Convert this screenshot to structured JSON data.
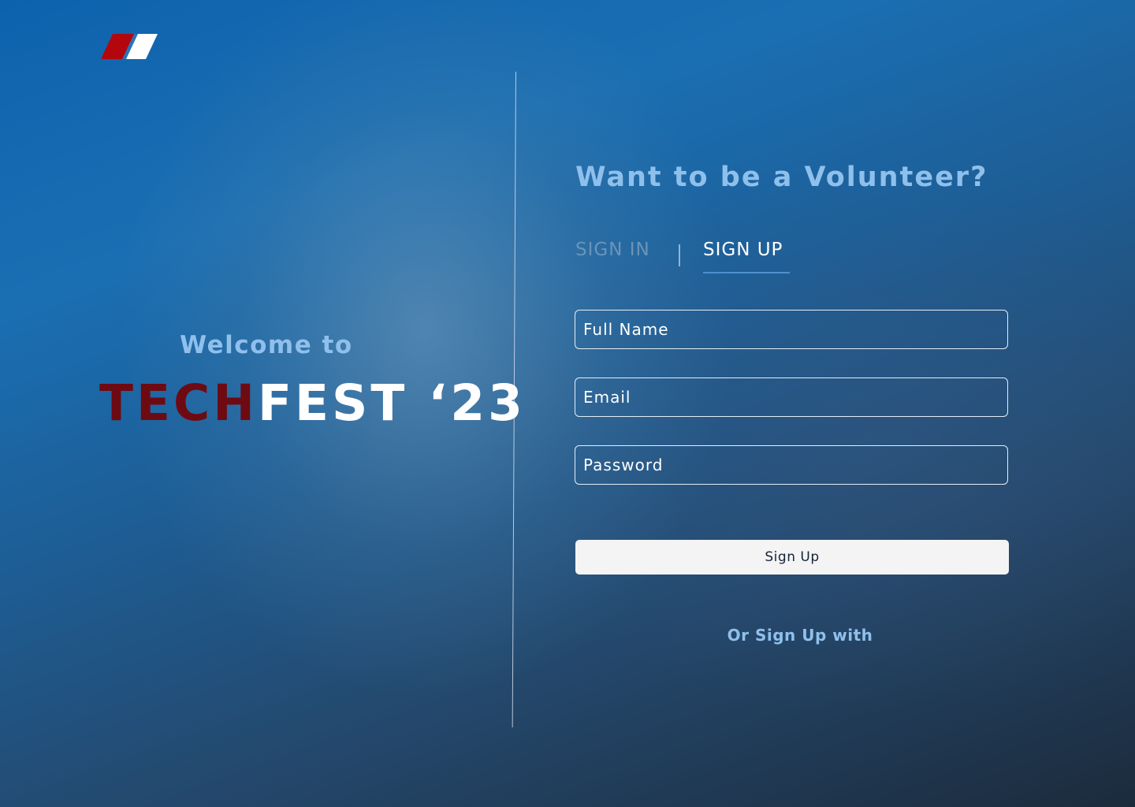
{
  "welcome": {
    "greeting": "Welcome to",
    "brand_part1": "TECH",
    "brand_part2": "FEST ‘23"
  },
  "form": {
    "headline": "Want to be a Volunteer?",
    "tabs": [
      {
        "label": "SIGN IN",
        "active": false
      },
      {
        "label": "SIGN UP",
        "active": true
      }
    ],
    "fields": {
      "full_name_placeholder": "Full Name",
      "email_placeholder": "Email",
      "password_placeholder": "Password"
    },
    "submit_label": "Sign Up",
    "alt_text": "Or Sign Up with"
  },
  "colors": {
    "accent_light_blue": "#8fc0ec",
    "brand_red": "#6e0a12",
    "logo_red": "#b3060d",
    "tab_underline": "#4f8fce",
    "button_bg": "#f4f4f4"
  },
  "icons": {
    "logo": "techfest-logo-stripes"
  }
}
